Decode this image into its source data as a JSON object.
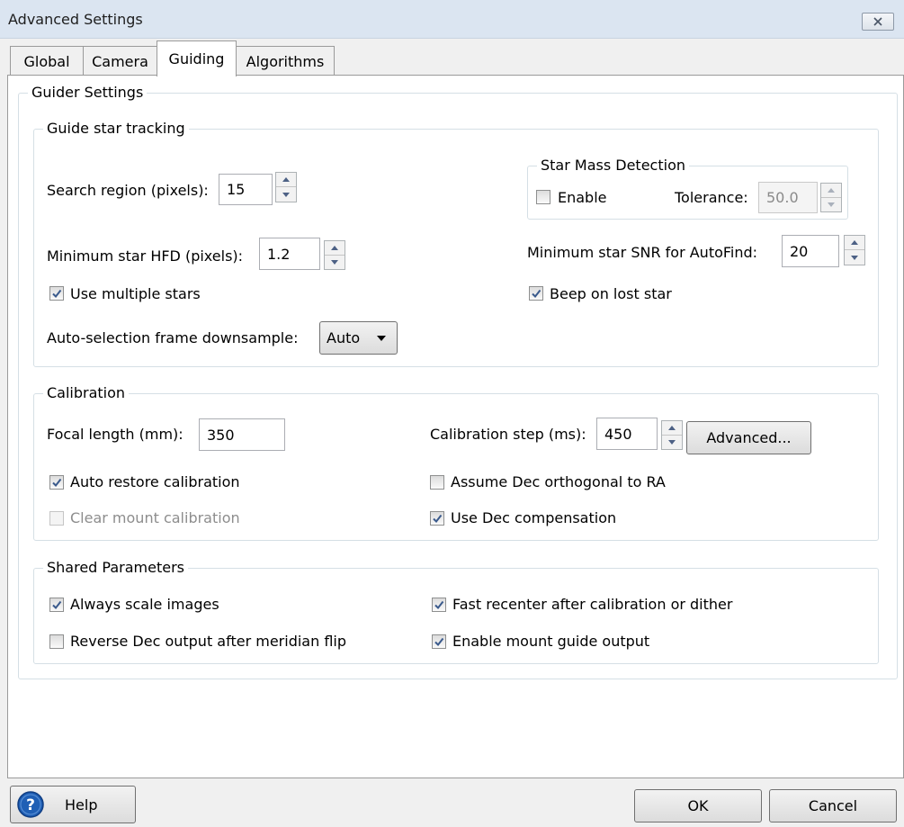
{
  "window": {
    "title": "Advanced Settings",
    "close_icon": "close-icon"
  },
  "tabs": [
    {
      "label": "Global"
    },
    {
      "label": "Camera"
    },
    {
      "label": "Guiding"
    },
    {
      "label": "Algorithms"
    }
  ],
  "active_tab": "Guiding",
  "guider_settings": {
    "label": "Guider Settings",
    "tracking": {
      "label": "Guide star tracking",
      "search_region_label": "Search region (pixels):",
      "search_region_value": "15",
      "min_hfd_label": "Minimum star HFD (pixels):",
      "min_hfd_value": "1.2",
      "use_multiple_stars_label": "Use multiple stars",
      "use_multiple_stars_checked": true,
      "downsample_label": "Auto-selection frame downsample:",
      "downsample_value": "Auto",
      "star_mass": {
        "label": "Star Mass Detection",
        "enable_label": "Enable",
        "enable_checked": false,
        "tolerance_label": "Tolerance:",
        "tolerance_value": "50.0"
      },
      "min_snr_label": "Minimum star SNR for AutoFind:",
      "min_snr_value": "20",
      "beep_label": "Beep on lost star",
      "beep_checked": true
    },
    "calibration": {
      "label": "Calibration",
      "focal_length_label": "Focal length (mm):",
      "focal_length_value": "350",
      "cal_step_label": "Calibration step (ms):",
      "cal_step_value": "450",
      "advanced_button": "Advanced...",
      "auto_restore_label": "Auto restore calibration",
      "auto_restore_checked": true,
      "clear_mount_label": "Clear mount calibration",
      "clear_mount_checked": false,
      "assume_dec_label": "Assume Dec orthogonal to RA",
      "assume_dec_checked": false,
      "use_dec_comp_label": "Use Dec compensation",
      "use_dec_comp_checked": true
    },
    "shared": {
      "label": "Shared Parameters",
      "always_scale_label": "Always scale images",
      "always_scale_checked": true,
      "reverse_dec_label": "Reverse Dec output after meridian flip",
      "reverse_dec_checked": false,
      "fast_recenter_label": "Fast recenter after calibration or dither",
      "fast_recenter_checked": true,
      "enable_mount_label": "Enable mount guide output",
      "enable_mount_checked": true
    }
  },
  "footer": {
    "help_button": "Help",
    "help_icon": "question-icon",
    "ok_button": "OK",
    "cancel_button": "Cancel"
  },
  "colors": {
    "title_bar": "#dbe5f1",
    "help_icon_blue": "#1f5fb5",
    "check_color": "#3a5a8c"
  }
}
